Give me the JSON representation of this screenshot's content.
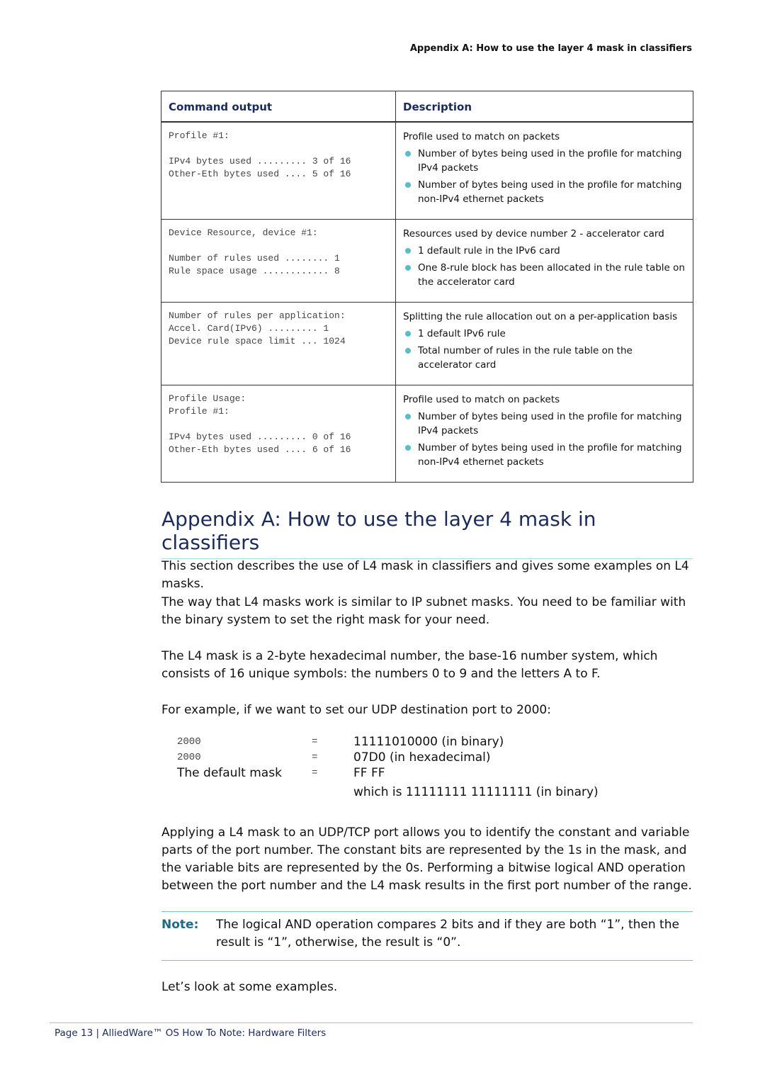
{
  "running_head": "Appendix A: How to use the layer 4 mask in classifiers",
  "table": {
    "headers": [
      "Command output",
      "Description"
    ],
    "rows": [
      {
        "output": "Profile #1:\n\nIPv4 bytes used ......... 3 of 16\nOther-Eth bytes used .... 5 of 16",
        "lead": "Profile used to match on packets",
        "bullets": [
          "Number of bytes being used in the profile for matching IPv4 packets",
          "Number of bytes being used in the profile for matching non-IPv4 ethernet packets"
        ]
      },
      {
        "output": "Device Resource, device #1:\n\nNumber of rules used ........ 1\nRule space usage ............ 8",
        "lead": "Resources used by device number 2 - accelerator card",
        "bullets": [
          "1 default rule in the IPv6 card",
          "One 8-rule block has been allocated in the rule table on the accelerator card"
        ]
      },
      {
        "output": "Number of rules per application:\nAccel. Card(IPv6) ......... 1\nDevice rule space limit ... 1024",
        "lead": "Splitting the rule allocation out on a per-application basis",
        "bullets": [
          "1 default IPv6 rule",
          "Total number of rules in the rule table on the accelerator card"
        ]
      },
      {
        "output": "Profile Usage:\nProfile #1:\n\nIPv4 bytes used ......... 0 of 16\nOther-Eth bytes used .... 6 of 16",
        "lead": "Profile used to match on packets",
        "bullets": [
          "Number of bytes being used in the profile for matching IPv4 packets",
          "Number of bytes being used in the profile for matching non-IPv4 ethernet packets"
        ]
      }
    ]
  },
  "section_title": "Appendix A: How to use the layer 4 mask in classifiers",
  "paragraphs": {
    "p1": "This section describes the use of L4 mask in classifiers and gives some examples on L4 masks.",
    "p2": "The way that L4 masks work is similar to IP subnet masks. You need to be familiar with the binary system to set the right mask for your need.",
    "p3": "The L4 mask is a 2-byte hexadecimal number, the base-16 number system, which consists of 16 unique symbols: the numbers 0 to 9 and the letters A to F.",
    "p4": "For example, if we want to set our UDP destination port to 2000:",
    "p5": "Applying a L4 mask to an UDP/TCP port allows you to identify the constant and variable parts of the port number. The constant bits are represented by the 1s in the mask, and the variable bits are represented by the 0s. Performing a bitwise logical AND operation between the port number and the L4 mask results in the first port number of the range.",
    "p6": "Let’s look at some examples."
  },
  "equations": [
    {
      "lhs": "2000",
      "op": "=",
      "rhs": "11111010000 (in binary)"
    },
    {
      "lhs": "2000",
      "op": "=",
      "rhs": "07D0 (in hexadecimal)"
    },
    {
      "lhs": "The default mask",
      "op": "=",
      "rhs": "FF FF"
    },
    {
      "lhs": "",
      "op": "",
      "rhs": "which is 11111111 11111111 (in binary)"
    }
  ],
  "note": {
    "label": "Note:",
    "text": "The logical AND operation compares 2 bits and if they are both “1”, then the result is “1”, otherwise, the result is “0”."
  },
  "footer": "Page 13 | AlliedWare™ OS How To Note: Hardware Filters",
  "colors": {
    "heading": "#1a2a5a",
    "bullet": "#5bbcc9",
    "note_label": "#1d6b85",
    "rule": "#6fc6d3"
  }
}
